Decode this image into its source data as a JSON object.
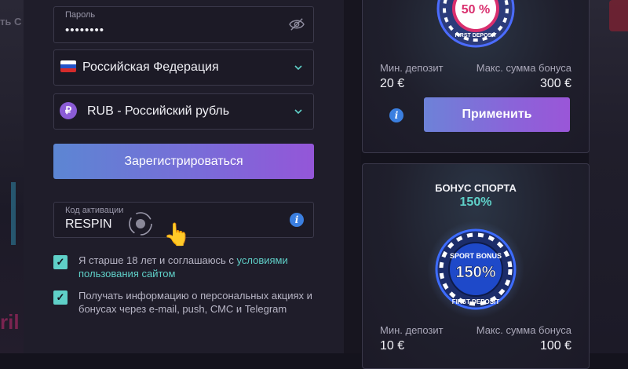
{
  "background": {
    "left_partial_text": "ть С",
    "left_partial_bottom": "ril"
  },
  "form": {
    "password": {
      "label": "Пароль",
      "value": "••••••••"
    },
    "country": {
      "value": "Российская Федерация"
    },
    "currency": {
      "symbol": "₽",
      "value": "RUB - Российский рубль"
    },
    "register_button": "Зарегистрироваться",
    "promo": {
      "label": "Код активации",
      "value": "RESPIN",
      "info": "i"
    },
    "terms": {
      "checked": true,
      "text": "Я старше 18 лет и соглашаюсь с ",
      "link": "условиями пользования сайтом"
    },
    "newsletter": {
      "checked": true,
      "text": "Получать информацию о персональных акциях и бонусах через e-mail, push, СМС и Telegram"
    }
  },
  "bonuses": [
    {
      "chip_pct": "50 %",
      "chip_caption": "FIRST DEPOSIT",
      "min_label": "Мин. депозит",
      "min_value": "20 €",
      "max_label": "Макс. сумма бонуса",
      "max_value": "300 €",
      "info": "i",
      "apply_button": "Применить"
    },
    {
      "title": "БОНУС СПОРТА",
      "percent": "150%",
      "chip_top": "SPORT BONUS",
      "chip_pct": "150%",
      "chip_caption": "FIRST DEPOSIT",
      "min_label": "Мин. депозит",
      "min_value": "10 €",
      "max_label": "Макс. сумма бонуса",
      "max_value": "100 €"
    }
  ],
  "colors": {
    "accent_teal": "#5fd0c8",
    "button_gradient_start": "#5c86d3",
    "button_gradient_end": "#9456d8",
    "info_blue": "#3b7fe0"
  },
  "icons": {
    "eye": "eye-slash-icon",
    "chevron": "chevron-down-icon",
    "check": "✓",
    "hand": "👆"
  }
}
